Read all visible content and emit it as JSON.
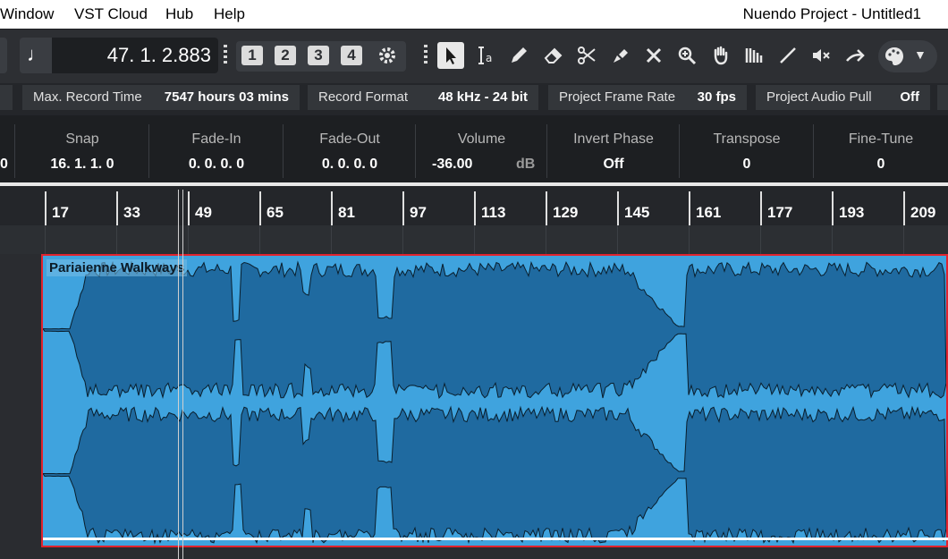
{
  "menubar": {
    "items": [
      "Window",
      "VST Cloud",
      "Hub",
      "Help"
    ],
    "title": "Nuendo Project - Untitled1"
  },
  "toolbar": {
    "position": "47. 1. 2.883",
    "markers": [
      "1",
      "2",
      "3",
      "4"
    ]
  },
  "status": [
    {
      "label": "Max. Record Time",
      "value": "7547 hours 03 mins"
    },
    {
      "label": "Record Format",
      "value": "48 kHz - 24 bit"
    },
    {
      "label": "Project Frame Rate",
      "value": "30 fps"
    },
    {
      "label": "Project Audio Pull",
      "value": "Off"
    }
  ],
  "infoline": {
    "left_value": "0",
    "fields": [
      {
        "label": "Snap",
        "value": "16. 1. 1.   0"
      },
      {
        "label": "Fade-In",
        "value": "0. 0. 0.   0"
      },
      {
        "label": "Fade-Out",
        "value": "0. 0. 0.   0"
      },
      {
        "label": "Volume",
        "value": "-36.00",
        "unit": "dB"
      },
      {
        "label": "Invert Phase",
        "value": "Off"
      },
      {
        "label": "Transpose",
        "value": "0"
      },
      {
        "label": "Fine-Tune",
        "value": "0"
      }
    ]
  },
  "ruler": [
    "17",
    "33",
    "49",
    "65",
    "81",
    "97",
    "113",
    "129",
    "145",
    "161",
    "177",
    "193",
    "209"
  ],
  "event": {
    "name": "Pariaienne Walkways"
  },
  "colors": {
    "event_fill": "#3fa3de",
    "waveform": "#1f6aa0",
    "selection_border": "#e1232e"
  }
}
